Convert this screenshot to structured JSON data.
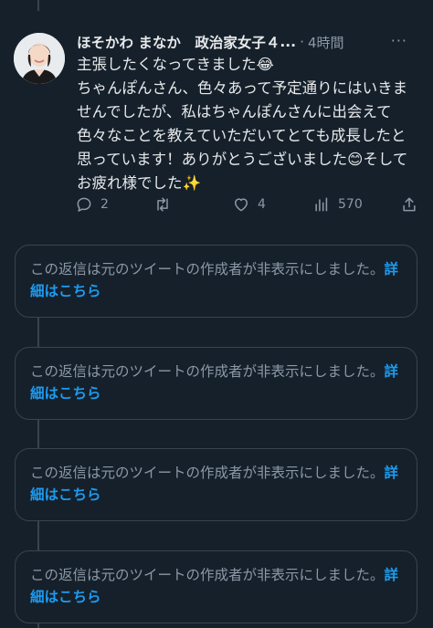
{
  "tweet": {
    "author": "ほそかわ まなか　政治家女子４",
    "author_ellipsis": "...",
    "separator": "·",
    "time": "4時間",
    "more_label": "···",
    "body_lines": [
      "主張したくなってきました😂",
      "ちゃんぽんさん、色々あって予定通りにはいきませんでしたが、私はちゃんぽんさんに出会えて色々なことを教えていただいてとても成長したと思っています！ありがとうございました😊そしてお疲れ様でした✨"
    ],
    "actions": {
      "reply_count": "2",
      "retweet_count": "",
      "like_count": "4",
      "views_count": "570"
    }
  },
  "hidden_replies": [
    {
      "text": "この返信は元のツイートの作成者が非表示にしました。",
      "link": "詳細はこちら"
    },
    {
      "text": "この返信は元のツイートの作成者が非表示にしました。",
      "link": "詳細はこちら"
    },
    {
      "text": "この返信は元のツイートの作成者が非表示にしました。",
      "link": "詳細はこちら"
    },
    {
      "text": "この返信は元のツイートの作成者が非表示にしました。",
      "link": "詳細はこちら"
    }
  ],
  "colors": {
    "background": "#15202b",
    "text": "#e7e9ea",
    "muted": "#8b98a5",
    "border": "#38444d",
    "link": "#1d9bf0"
  }
}
